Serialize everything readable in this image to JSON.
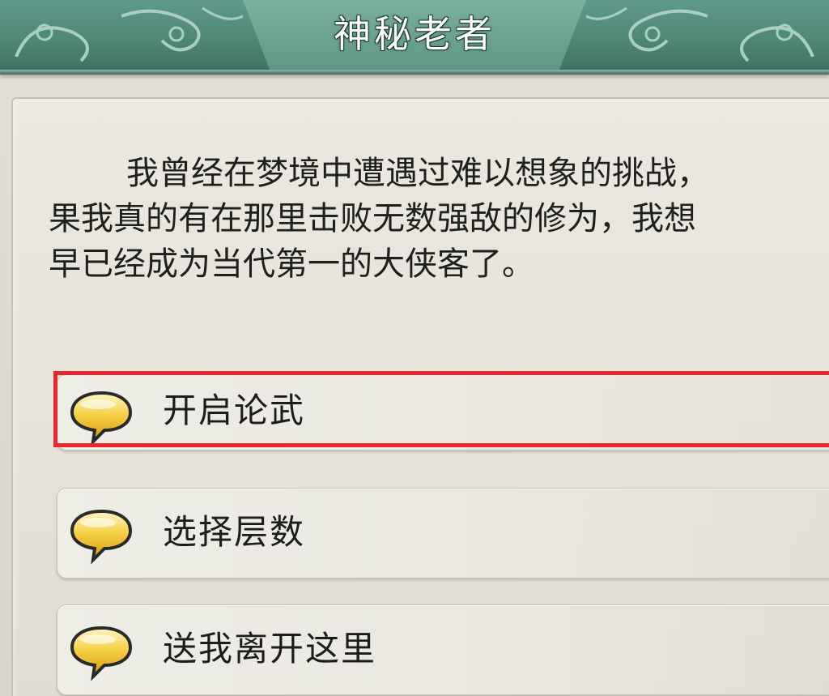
{
  "dialog": {
    "title": "神秘老者",
    "lines": [
      "我曾经在梦境中遭遇过难以想象的挑战，",
      "果我真的有在那里击败无数强敌的修为，我想",
      "早已经成为当代第一的大侠客了。"
    ]
  },
  "options": [
    {
      "label": "开启论武",
      "icon": "speech-bubble-icon",
      "highlighted": true
    },
    {
      "label": "选择层数",
      "icon": "speech-bubble-icon",
      "highlighted": false
    },
    {
      "label": "送我离开这里",
      "icon": "speech-bubble-icon",
      "highlighted": false
    }
  ],
  "colors": {
    "banner": "#4f8676",
    "highlight": "#e8262d",
    "bubble": "#f0b51c"
  }
}
